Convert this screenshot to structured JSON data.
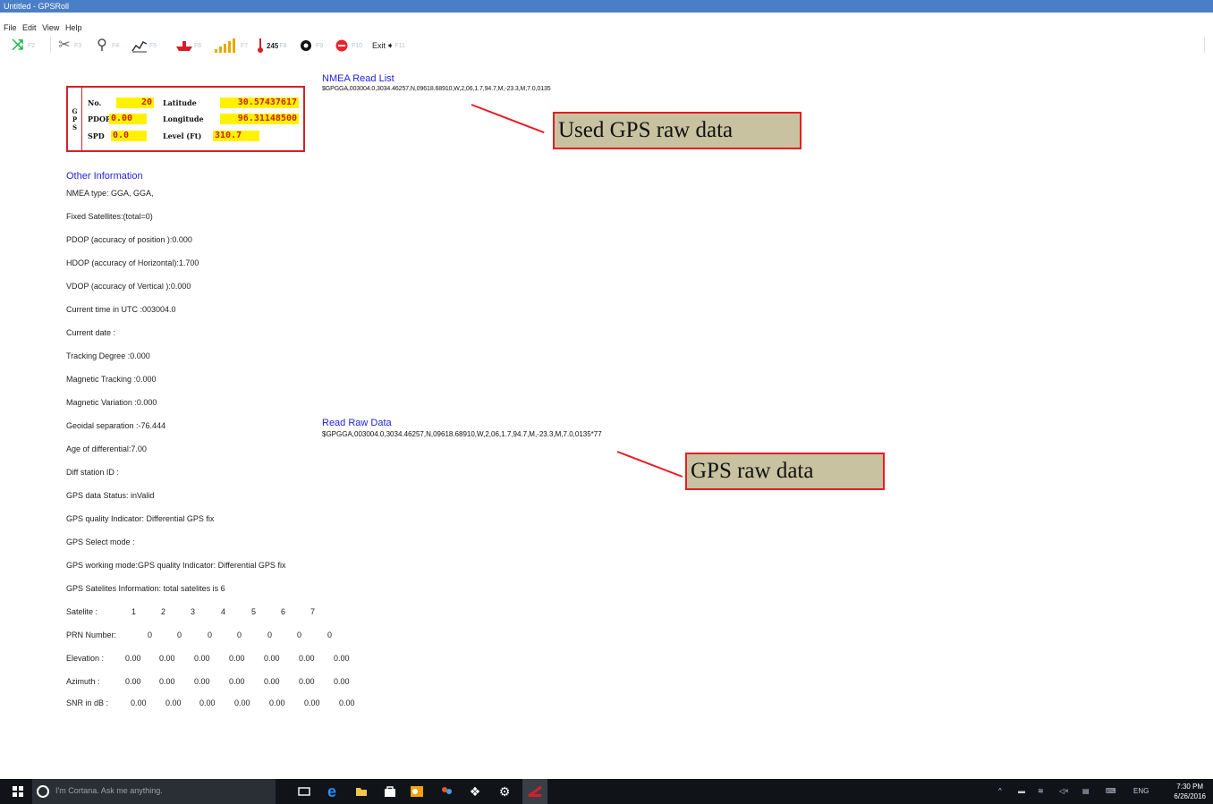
{
  "window": {
    "title": "Untitled - GPSRoll"
  },
  "menu": [
    "File",
    "Edit",
    "View",
    "Help"
  ],
  "toolbar": {
    "keys": [
      "F2",
      "F3",
      "F4",
      "F5",
      "F6",
      "F7",
      "F8",
      "F9",
      "F10",
      "F11"
    ],
    "temp_value": "245",
    "exit_label": "Exit"
  },
  "gps_panel": {
    "side_label": [
      "G",
      "P",
      "S"
    ],
    "no_label": "No.",
    "no_value": "20",
    "pdop_label": "PDOP",
    "pdop_value": "0.00",
    "spd_label": "SPD",
    "spd_value": "0.0",
    "lat_label": "Latitude",
    "lat_value": "30.57437617",
    "lon_label": "Longitude",
    "lon_value": "96.31148500",
    "level_label": "Level (Ft)",
    "level_value": "310.7"
  },
  "nmea_read_list": {
    "title": "NMEA Read List",
    "text": "$GPGGA,003004.0,3034.46257,N,09618.68910,W,2,06,1.7,94.7,M,-23.3,M,7.0,0135"
  },
  "read_raw_data": {
    "title": "Read Raw Data",
    "text": "$GPGGA,003004.0,3034.46257,N,09618.68910,W,2,06,1.7,94.7,M,-23.3,M,7.0,0135*77"
  },
  "other_info": {
    "title": "Other Information",
    "lines": [
      "NMEA type: GGA, GGA,",
      "Fixed Satellites:(total=0)",
      "PDOP (accuracy of position  ):0.000",
      "HDOP (accuracy of Horizontal):1.700",
      "VDOP (accuracy of Vertical  ):0.000",
      "Current time in UTC :003004.0",
      "Current date     :",
      "Tracking Degree    :0.000",
      "Magnetic Tracking  :0.000",
      "Magnetic Variation  :0.000",
      "Geoidal separation :-76.444",
      "Age of differential:7.00",
      "Diff station ID   :",
      "GPS data Status: inValid",
      "GPS quality Indicator: Differential GPS fix",
      "GPS Select mode :",
      "GPS working mode:GPS quality Indicator: Differential GPS fix",
      "GPS Satelites Information: total satelites is 6"
    ]
  },
  "satellites": {
    "satelite_label": "Satelite :",
    "satelite_values": [
      "1",
      "2",
      "3",
      "4",
      "5",
      "6",
      "7"
    ],
    "prn_label": "PRN Number:",
    "prn_values": [
      "0",
      "0",
      "0",
      "0",
      "0",
      "0",
      "0"
    ],
    "elevation_label": "Elevation :",
    "elevation_values": [
      "0.00",
      "0.00",
      "0.00",
      "0.00",
      "0.00",
      "0.00",
      "0.00"
    ],
    "azimuth_label": "Azimuth  :",
    "azimuth_values": [
      "0.00",
      "0.00",
      "0.00",
      "0.00",
      "0.00",
      "0.00",
      "0.00"
    ],
    "snr_label": "SNR in dB :",
    "snr_values": [
      "0.00",
      "0.00",
      "0.00",
      "0.00",
      "0.00",
      "0.00",
      "0.00"
    ]
  },
  "annotations": {
    "used_raw": "Used GPS raw data",
    "raw": "GPS raw data"
  },
  "taskbar": {
    "search_placeholder": "I'm Cortana. Ask me anything.",
    "language": "ENG",
    "time": "7:30 PM",
    "date": "6/26/2016"
  },
  "colors": {
    "accent_blue": "#2222dd",
    "highlight_yellow": "#fff200",
    "value_red": "#cc2200",
    "annotation_red": "#e81c24",
    "annotation_fill": "#c8c2a0"
  }
}
